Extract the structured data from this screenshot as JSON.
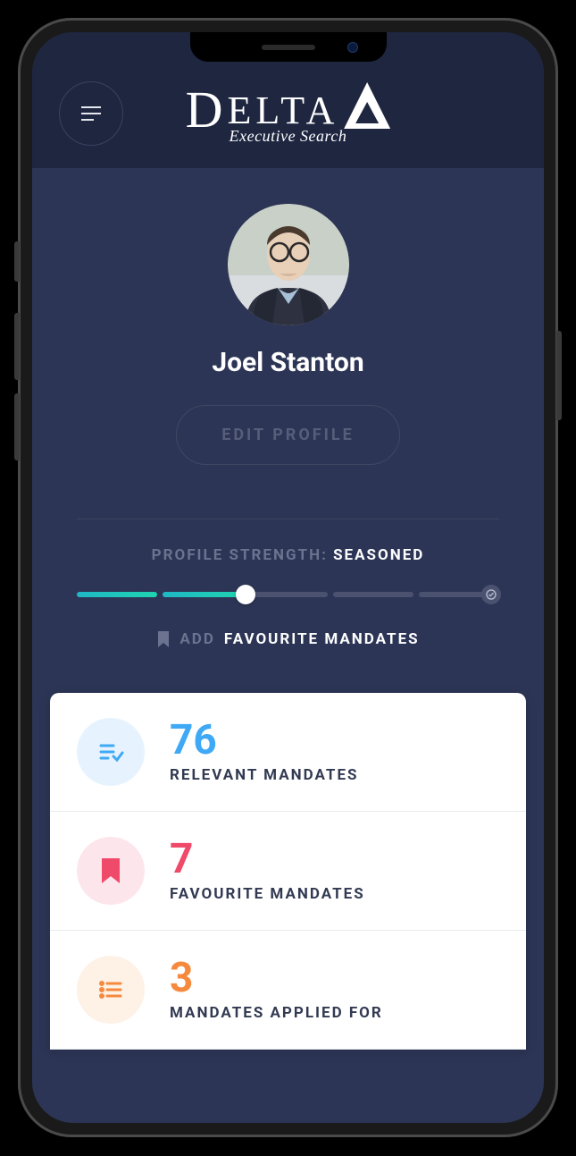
{
  "brand": {
    "name": "DELTA",
    "tagline": "Executive Search"
  },
  "profile": {
    "name": "Joel Stanton",
    "edit_label": "EDIT PROFILE"
  },
  "strength": {
    "label": "PROFILE STRENGTH:",
    "value": "SEASONED",
    "filled_segments": 2,
    "total_segments": 5
  },
  "add_fav": {
    "prefix": "ADD",
    "label": "FAVOURITE MANDATES"
  },
  "stats": [
    {
      "count": "76",
      "label": "RELEVANT MANDATES",
      "color": "blue",
      "icon": "list-check"
    },
    {
      "count": "7",
      "label": "FAVOURITE MANDATES",
      "color": "pink",
      "icon": "bookmark"
    },
    {
      "count": "3",
      "label": "MANDATES APPLIED FOR",
      "color": "orange",
      "icon": "list"
    }
  ]
}
